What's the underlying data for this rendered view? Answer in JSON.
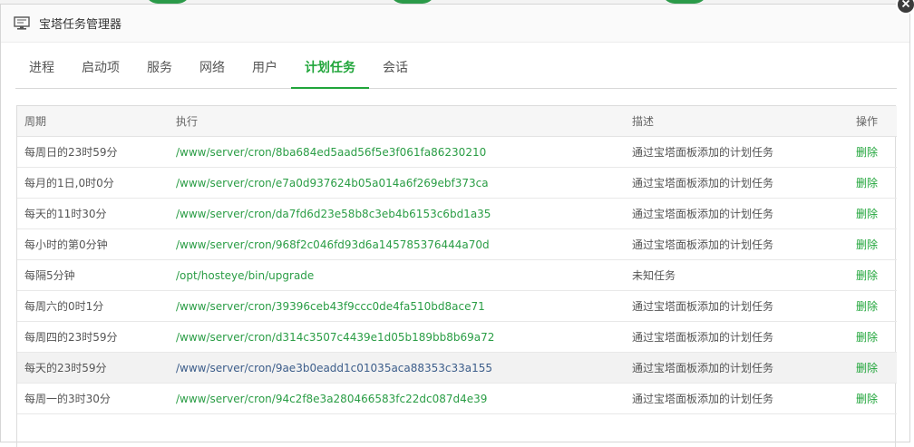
{
  "window": {
    "title": "宝塔任务管理器"
  },
  "tabs": [
    {
      "label": "进程",
      "active": false
    },
    {
      "label": "启动项",
      "active": false
    },
    {
      "label": "服务",
      "active": false
    },
    {
      "label": "网络",
      "active": false
    },
    {
      "label": "用户",
      "active": false
    },
    {
      "label": "计划任务",
      "active": true
    },
    {
      "label": "会话",
      "active": false
    }
  ],
  "table": {
    "headers": {
      "period": "周期",
      "exec": "执行",
      "desc": "描述",
      "op": "操作"
    },
    "rows": [
      {
        "period": "每周日的23时59分",
        "exec": "/www/server/cron/8ba684ed5aad56f5e3f061fa86230210",
        "desc": "通过宝塔面板添加的计划任务",
        "op": "删除"
      },
      {
        "period": "每月的1日,0时0分",
        "exec": "/www/server/cron/e7a0d937624b05a014a6f269ebf373ca",
        "desc": "通过宝塔面板添加的计划任务",
        "op": "删除"
      },
      {
        "period": "每天的11时30分",
        "exec": "/www/server/cron/da7fd6d23e58b8c3eb4b6153c6bd1a35",
        "desc": "通过宝塔面板添加的计划任务",
        "op": "删除"
      },
      {
        "period": "每小时的第0分钟",
        "exec": "/www/server/cron/968f2c046fd93d6a145785376444a70d",
        "desc": "通过宝塔面板添加的计划任务",
        "op": "删除"
      },
      {
        "period": "每隔5分钟",
        "exec": "/opt/hosteye/bin/upgrade",
        "desc": "未知任务",
        "op": "删除"
      },
      {
        "period": "每周六的0时1分",
        "exec": "/www/server/cron/39396ceb43f9ccc0de4fa510bd8ace71",
        "desc": "通过宝塔面板添加的计划任务",
        "op": "删除"
      },
      {
        "period": "每周四的23时59分",
        "exec": "/www/server/cron/d314c3507c4439e1d05b189bb8b69a72",
        "desc": "通过宝塔面板添加的计划任务",
        "op": "删除"
      },
      {
        "period": "每天的23时59分",
        "exec": "/www/server/cron/9ae3b0eadd1c01035aca88353c33a155",
        "desc": "通过宝塔面板添加的计划任务",
        "op": "删除",
        "highlighted": true
      },
      {
        "period": "每周一的3时30分",
        "exec": "/www/server/cron/94c2f8e3a280466583fc22dc087d4e39",
        "desc": "通过宝塔面板添加的计划任务",
        "op": "删除"
      }
    ]
  },
  "colors": {
    "accent": "#20a53a",
    "highlight_link": "#3c5d8a"
  },
  "icons": {
    "title": "monitor-icon",
    "close": "close-icon"
  }
}
